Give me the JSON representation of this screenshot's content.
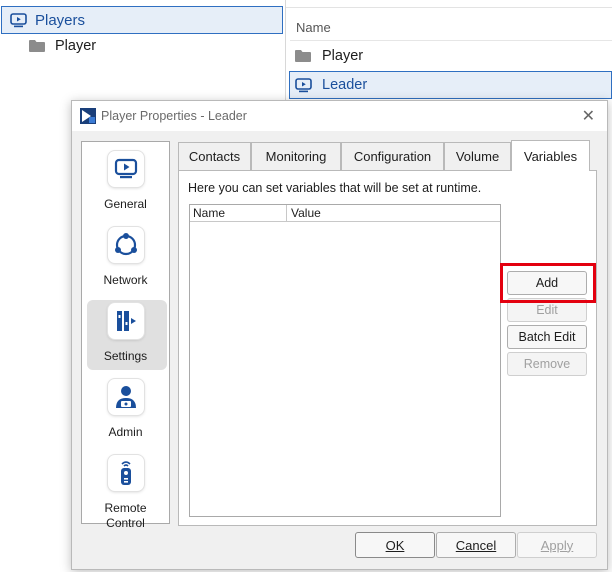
{
  "explorer": {
    "tree_root_label": "Players",
    "tree_child_label": "Player",
    "column_header": "Name",
    "list_items": [
      "Player",
      "Leader"
    ]
  },
  "dialog": {
    "title": "Player Properties - Leader",
    "close_glyph": "✕",
    "nav": [
      {
        "label": "General",
        "icon": "monitor-play-icon"
      },
      {
        "label": "Network",
        "icon": "network-nodes-icon"
      },
      {
        "label": "Settings",
        "icon": "settings-columns-icon"
      },
      {
        "label": "Admin",
        "icon": "admin-user-icon"
      },
      {
        "label": "Remote Control",
        "icon": "remote-control-icon"
      }
    ],
    "selected_nav": "Settings",
    "tabs": [
      "Contacts",
      "Monitoring",
      "Configuration",
      "Volume",
      "Variables"
    ],
    "active_tab": "Variables",
    "hint": "Here you can set variables that will be set at runtime.",
    "table_columns": [
      "Name",
      "Value"
    ],
    "side_buttons": {
      "add": "Add",
      "edit": "Edit",
      "batch_edit": "Batch Edit",
      "remove": "Remove"
    },
    "footer_buttons": {
      "ok": "OK",
      "cancel": "Cancel",
      "apply": "Apply"
    }
  },
  "colors": {
    "accent_blue": "#1a4f9c",
    "highlight_red": "#e3000f"
  }
}
